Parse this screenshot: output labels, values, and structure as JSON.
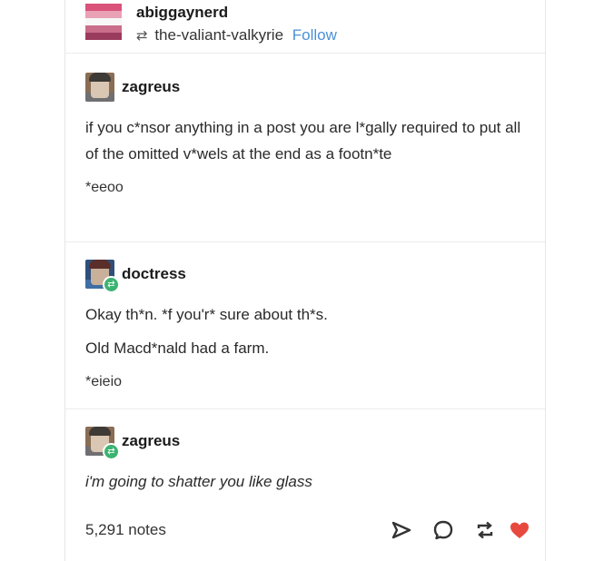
{
  "header": {
    "blog_name": "abiggaynerd",
    "reblogged_from": "the-valiant-valkyrie",
    "follow_label": "Follow",
    "flag_colors": [
      "#d9537a",
      "#e9a1b5",
      "#ffffff",
      "#c96d8a",
      "#9a3b5e"
    ]
  },
  "posts": [
    {
      "username": "zagreus",
      "paragraphs": [
        "if you c*nsor anything in a post you are l*gally required to put all of the omitted v*wels at the end as a footn*te"
      ],
      "footnote": "*eeoo"
    },
    {
      "username": "doctress",
      "paragraphs": [
        "Okay th*n. *f you'r* sure about th*s.",
        "Old Macd*nald had a farm."
      ],
      "footnote": "*eieio"
    },
    {
      "username": "zagreus",
      "paragraphs": [
        "i'm going to shatter you like glass"
      ]
    }
  ],
  "footer": {
    "notes": "5,291 notes",
    "icons": [
      "share-icon",
      "reply-icon",
      "reblog-icon",
      "like-icon"
    ],
    "like_color": "#e8493f"
  }
}
